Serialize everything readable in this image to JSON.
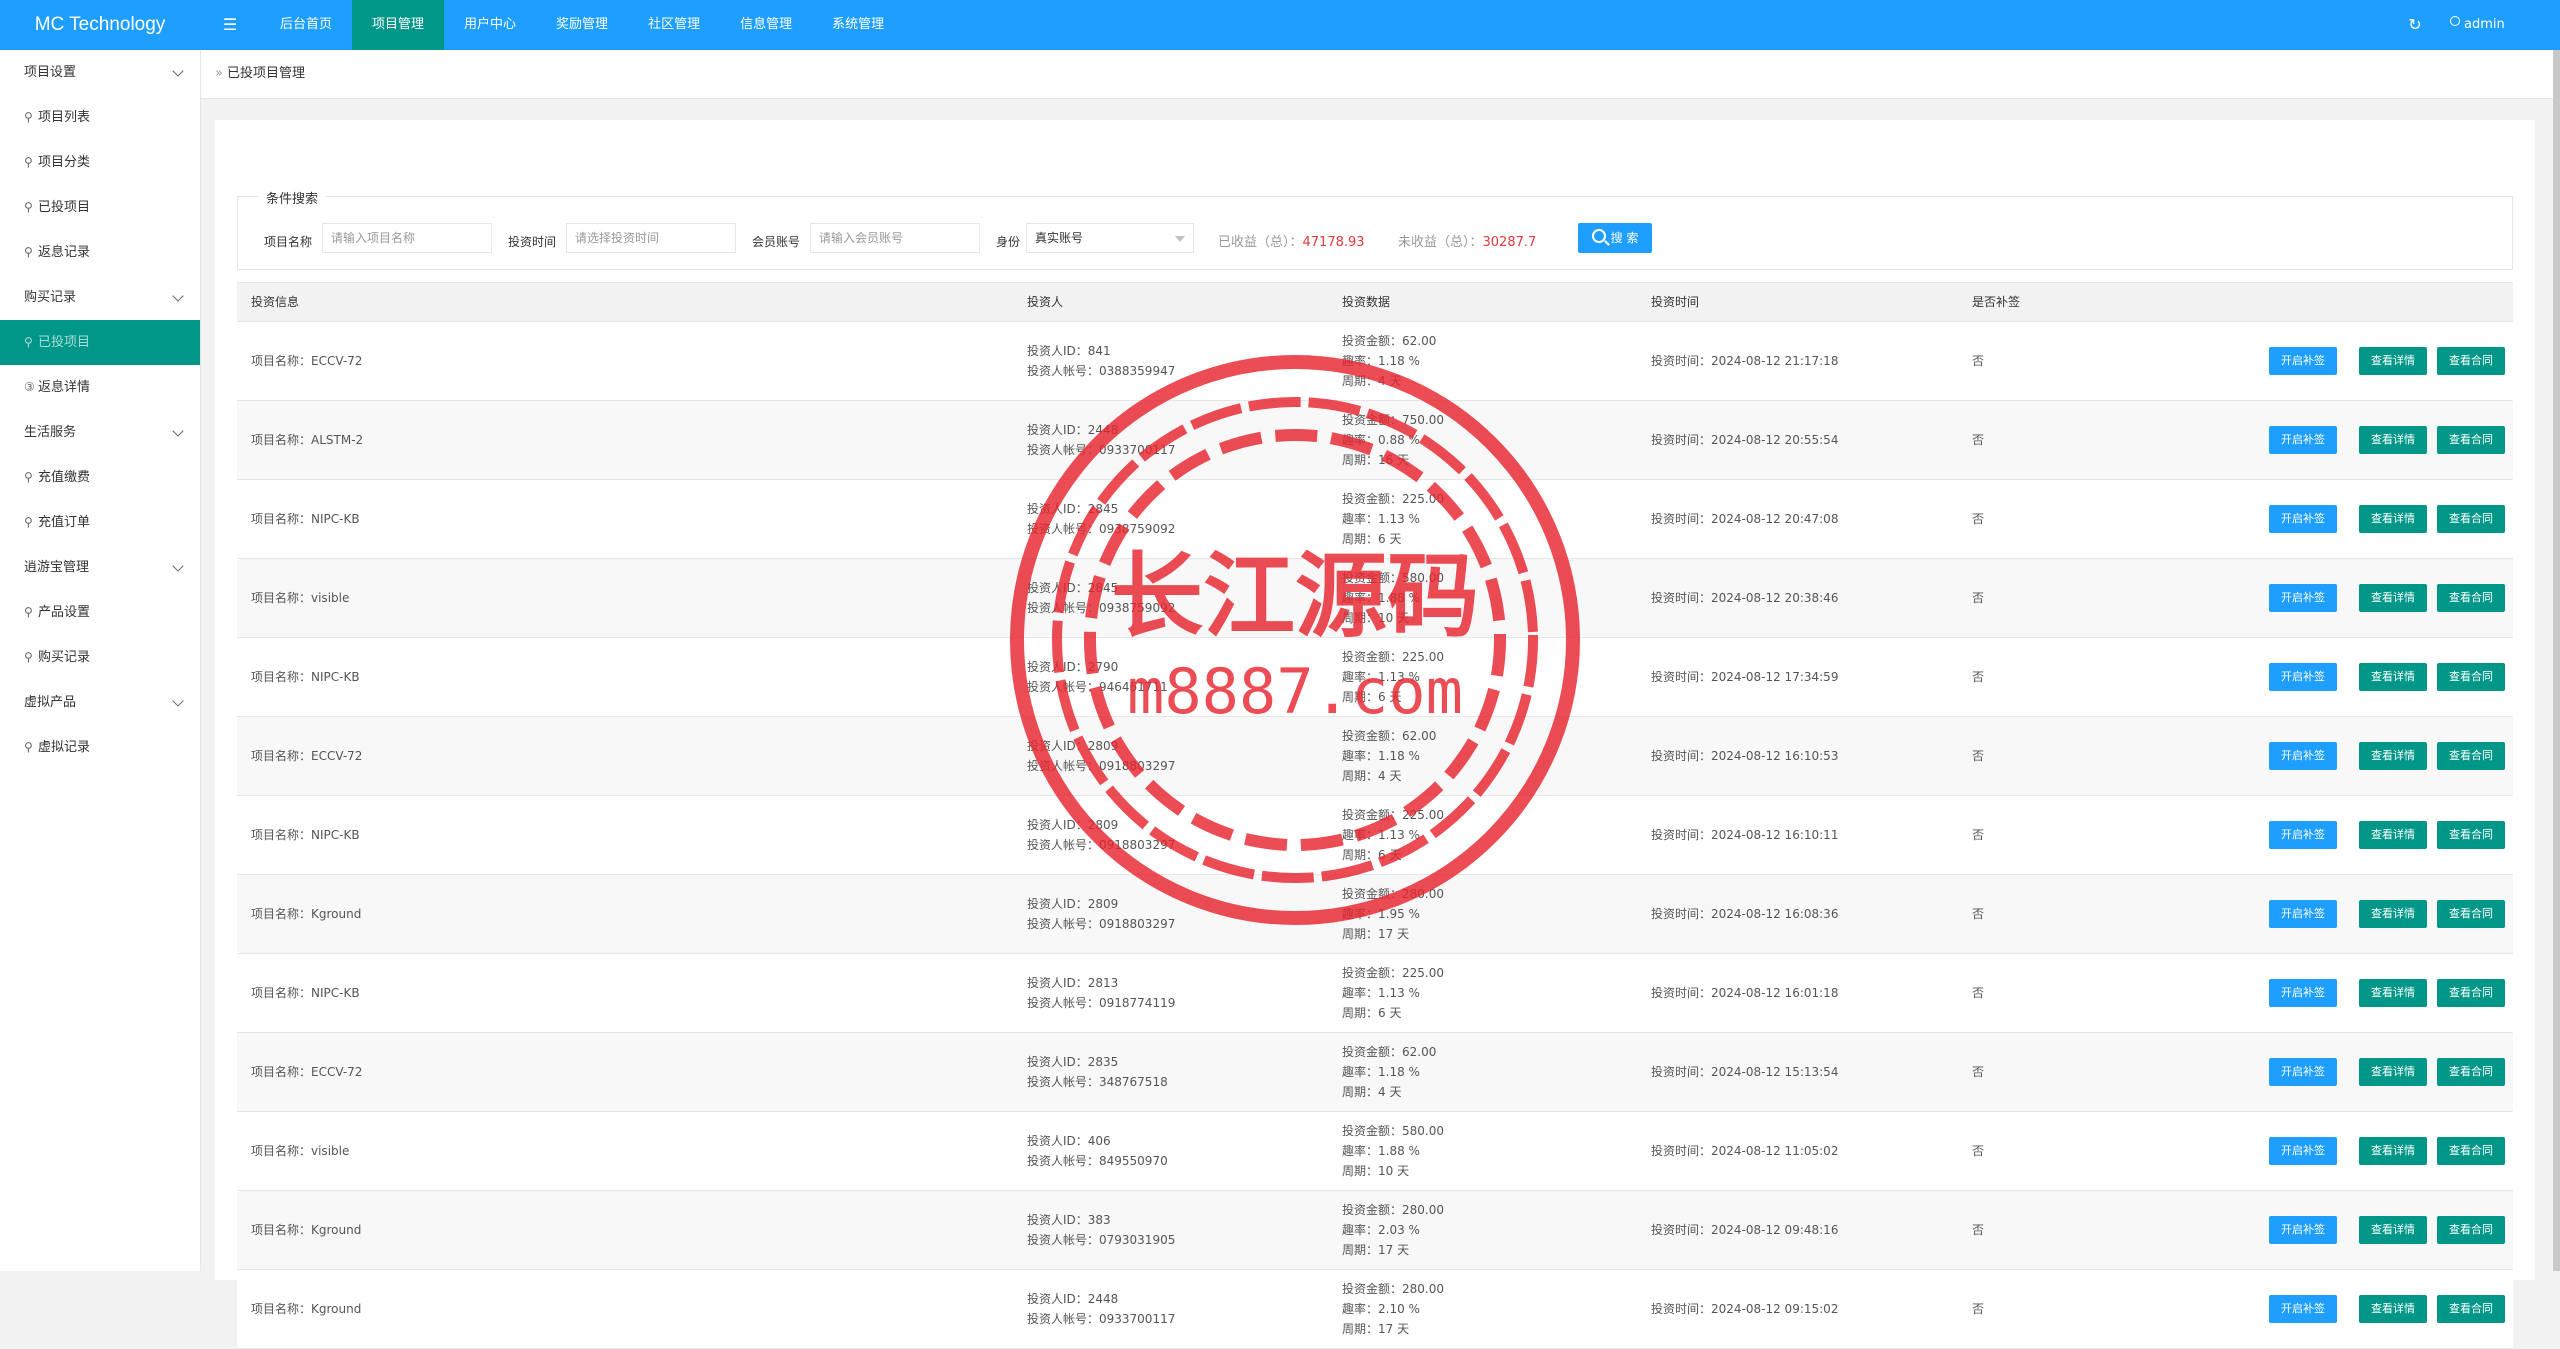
{
  "app": {
    "title": "MC Technology"
  },
  "header": {
    "nav": [
      "后台首页",
      "项目管理",
      "用户中心",
      "奖励管理",
      "社区管理",
      "信息管理",
      "系统管理"
    ],
    "active_nav_index": 1,
    "user": "admin",
    "icons": {
      "menu": "hamburger-icon",
      "refresh": "refresh-icon",
      "user": "user-icon"
    }
  },
  "sidebar": {
    "groups": [
      {
        "label": "项目设置",
        "items": [
          {
            "label": "项目列表",
            "icon": "link-icon"
          },
          {
            "label": "项目分类",
            "icon": "link-icon"
          },
          {
            "label": "已投项目",
            "icon": "link-icon"
          },
          {
            "label": "返息记录",
            "icon": "link-icon"
          }
        ]
      },
      {
        "label": "购买记录",
        "items": [
          {
            "label": "已投项目",
            "icon": "link-icon",
            "active": true
          },
          {
            "label": "返息详情",
            "icon": "circle-3-icon"
          }
        ]
      },
      {
        "label": "生活服务",
        "items": [
          {
            "label": "充值缴费",
            "icon": "link-icon"
          },
          {
            "label": "充值订单",
            "icon": "link-icon"
          }
        ]
      },
      {
        "label": "逍游宝管理",
        "items": [
          {
            "label": "产品设置",
            "icon": "link-icon"
          },
          {
            "label": "购买记录",
            "icon": "link-icon"
          }
        ]
      },
      {
        "label": "虚拟产品",
        "items": [
          {
            "label": "虚拟记录",
            "icon": "link-icon"
          }
        ]
      }
    ]
  },
  "breadcrumb": "已投项目管理",
  "search": {
    "legend": "条件搜索",
    "project_label": "项目名称",
    "project_placeholder": "请输入项目名称",
    "time_label": "投资时间",
    "time_placeholder": "请选择投资时间",
    "account_label": "会员账号",
    "account_placeholder": "请输入会员账号",
    "identity_label": "身份",
    "identity_value": "真实账号",
    "earned_label": "已收益（总）：",
    "earned_value": "47178.93",
    "unearned_label": "未收益（总）：",
    "unearned_value": "30287.7",
    "button": "搜 索"
  },
  "table": {
    "headers": [
      "投资信息",
      "投资人",
      "投资数据",
      "投资时间",
      "是否补签"
    ],
    "buttons": {
      "add": "开启补签",
      "detail": "查看详情",
      "contract": "查看合同"
    },
    "rows": [
      {
        "project": "项目名称：ECCV-72",
        "investor_id": "投资人ID：841",
        "investor_account": "投资人帐号：0388359947",
        "amount": "投资金额：62.00",
        "rate": "趣率：1.18 %",
        "period": "周期：4 天",
        "time": "投资时间：2024-08-12 21:17:18",
        "resign": "否"
      },
      {
        "project": "项目名称：ALSTM-2",
        "investor_id": "投资人ID：2448",
        "investor_account": "投资人帐号：0933700117",
        "amount": "投资金额：750.00",
        "rate": "趣率：0.88 %",
        "period": "周期：16 天",
        "time": "投资时间：2024-08-12 20:55:54",
        "resign": "否"
      },
      {
        "project": "项目名称：NIPC-KB",
        "investor_id": "投资人ID：2845",
        "investor_account": "投资人帐号：0938759092",
        "amount": "投资金额：225.00",
        "rate": "趣率：1.13 %",
        "period": "周期：6 天",
        "time": "投资时间：2024-08-12 20:47:08",
        "resign": "否"
      },
      {
        "project": "项目名称：visible",
        "investor_id": "投资人ID：2845",
        "investor_account": "投资人帐号：0938759092",
        "amount": "投资金额：580.00",
        "rate": "趣率：1.88 %",
        "period": "周期：10 天",
        "time": "投资时间：2024-08-12 20:38:46",
        "resign": "否"
      },
      {
        "project": "项目名称：NIPC-KB",
        "investor_id": "投资人ID：2790",
        "investor_account": "投资人帐号：946461711",
        "amount": "投资金额：225.00",
        "rate": "趣率：1.13 %",
        "period": "周期：6 天",
        "time": "投资时间：2024-08-12 17:34:59",
        "resign": "否"
      },
      {
        "project": "项目名称：ECCV-72",
        "investor_id": "投资人ID：2809",
        "investor_account": "投资人帐号：0918803297",
        "amount": "投资金额：62.00",
        "rate": "趣率：1.18 %",
        "period": "周期：4 天",
        "time": "投资时间：2024-08-12 16:10:53",
        "resign": "否"
      },
      {
        "project": "项目名称：NIPC-KB",
        "investor_id": "投资人ID：2809",
        "investor_account": "投资人帐号：0918803297",
        "amount": "投资金额：225.00",
        "rate": "趣率：1.13 %",
        "period": "周期：6 天",
        "time": "投资时间：2024-08-12 16:10:11",
        "resign": "否"
      },
      {
        "project": "项目名称：Kground",
        "investor_id": "投资人ID：2809",
        "investor_account": "投资人帐号：0918803297",
        "amount": "投资金额：280.00",
        "rate": "趣率：1.95 %",
        "period": "周期：17 天",
        "time": "投资时间：2024-08-12 16:08:36",
        "resign": "否"
      },
      {
        "project": "项目名称：NIPC-KB",
        "investor_id": "投资人ID：2813",
        "investor_account": "投资人帐号：0918774119",
        "amount": "投资金额：225.00",
        "rate": "趣率：1.13 %",
        "period": "周期：6 天",
        "time": "投资时间：2024-08-12 16:01:18",
        "resign": "否"
      },
      {
        "project": "项目名称：ECCV-72",
        "investor_id": "投资人ID：2835",
        "investor_account": "投资人帐号：348767518",
        "amount": "投资金额：62.00",
        "rate": "趣率：1.18 %",
        "period": "周期：4 天",
        "time": "投资时间：2024-08-12 15:13:54",
        "resign": "否"
      },
      {
        "project": "项目名称：visible",
        "investor_id": "投资人ID：406",
        "investor_account": "投资人帐号：849550970",
        "amount": "投资金额：580.00",
        "rate": "趣率：1.88 %",
        "period": "周期：10 天",
        "time": "投资时间：2024-08-12 11:05:02",
        "resign": "否"
      },
      {
        "project": "项目名称：Kground",
        "investor_id": "投资人ID：383",
        "investor_account": "投资人帐号：0793031905",
        "amount": "投资金额：280.00",
        "rate": "趣率：2.03 %",
        "period": "周期：17 天",
        "time": "投资时间：2024-08-12 09:48:16",
        "resign": "否"
      },
      {
        "project": "项目名称：Kground",
        "investor_id": "投资人ID：2448",
        "investor_account": "投资人帐号：0933700117",
        "amount": "投资金额：280.00",
        "rate": "趣率：2.10 %",
        "period": "周期：17 天",
        "time": "投资时间：2024-08-12 09:15:02",
        "resign": "否"
      }
    ]
  },
  "watermark": {
    "title": "长江源码",
    "url": "m8887.com",
    "color": "#e8262f"
  }
}
